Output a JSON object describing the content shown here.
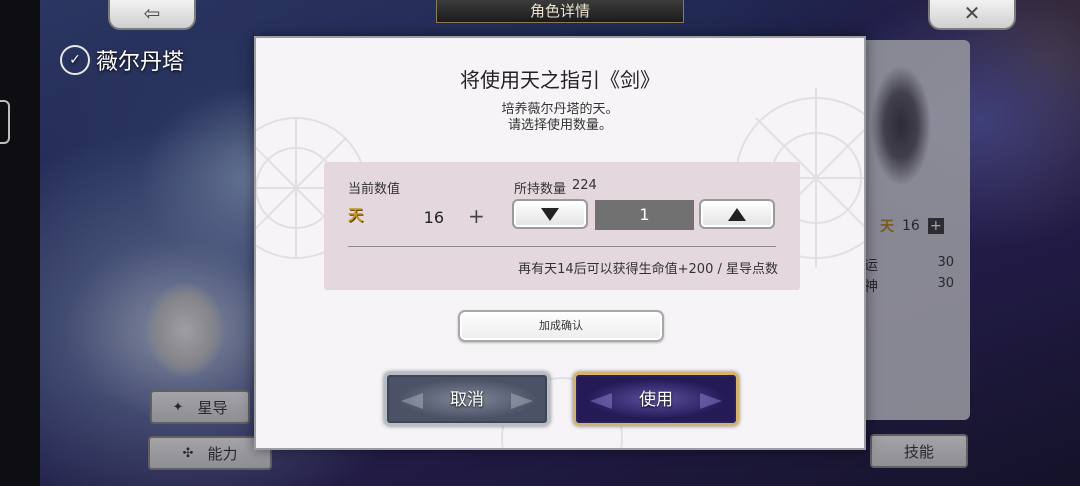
{
  "background": {
    "top_title": "角色详情",
    "back_icon": "back-arrow-icon",
    "close_icon": "close-icon",
    "character_name": "薇尔丹塔",
    "bottom_buttons": [
      {
        "label": "星导",
        "icon": "star-guide-icon"
      },
      {
        "label": "能力",
        "icon": "ability-icon"
      },
      {
        "label": "技能"
      }
    ],
    "right_panel": {
      "tian_count": "16",
      "stats": [
        {
          "label": "运",
          "value": "30"
        },
        {
          "label": "神",
          "value": "30"
        }
      ]
    }
  },
  "modal": {
    "title": "将使用天之指引《剑》",
    "desc_line1": "培养薇尔丹塔的天。",
    "desc_line2": "请选择使用数量。",
    "current_label": "当前数值",
    "current_icon_text": "天",
    "current_value": "16",
    "plus": "+",
    "owned_label": "所持数量",
    "owned_count": "224",
    "quantity": "1",
    "hint": "再有天14后可以获得生命值+200 / 星导点数",
    "confirm_label": "加成确认",
    "cancel_label": "取消",
    "use_label": "使用"
  },
  "colors": {
    "modal_bg": "#f6f4f6",
    "box_bg": "#e4d7de",
    "quantity_bg": "#717171",
    "use_border": "#d4b46a",
    "tian_gold": "#c8961c"
  }
}
